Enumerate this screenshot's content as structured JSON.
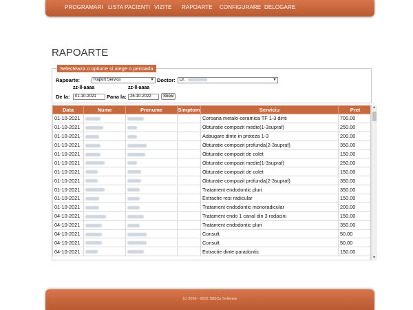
{
  "nav": {
    "items": [
      "PROGRAMARI",
      "LISTA PACIENTI",
      "VIZITE",
      "RAPOARTE",
      "CONFIGURARE",
      "DELOGARE"
    ]
  },
  "page_title": "RAPOARTE",
  "filter": {
    "legend": "Selecteaza o optiune si alege o perioada",
    "rapoarte_label": "Rapoarte:",
    "rapoarte_value": "Raport Servicii",
    "doctor_label": "Doctor:",
    "doctor_value": "Dr.",
    "date_hint_1": "zz-ll-aaaa",
    "date_hint_2": "zz-ll-aaaa",
    "de_la_label": "De la:",
    "de_la_value": "01-10-2021",
    "pana_la_label": "Pana la:",
    "pana_la_value": "26-10-2022",
    "show_button": "Show"
  },
  "table": {
    "headers": [
      "Data",
      "Nume",
      "Prenume",
      "Simptom",
      "Serviciu",
      "Pret"
    ],
    "rows": [
      [
        "01-10-2021",
        "Coroana metalo-ceramica TF 1-3 dinti",
        "700.00"
      ],
      [
        "01-10-2021",
        "Obturatie compozit medie(1-3supraf)",
        "250.00"
      ],
      [
        "01-10-2021",
        "Adaugare dinte in proteza 1-3",
        "200.00"
      ],
      [
        "01-10-2021",
        "Obturatie compozit profunda(2-3supraf)",
        "350.00"
      ],
      [
        "01-10-2021",
        "Obturatie compozit de colet",
        "150.00"
      ],
      [
        "01-10-2021",
        "Obturatie compozit medie(1-3supraf)",
        "250.00"
      ],
      [
        "01-10-2021",
        "Obturatie compozit de colet",
        "150.00"
      ],
      [
        "01-10-2021",
        "Obturatie compozit profunda(2-3supraf)",
        "350.00"
      ],
      [
        "01-10-2021",
        "Tratament endodontic pluri",
        "350.00"
      ],
      [
        "01-10-2021",
        "Extractie rest radicular",
        "150.00"
      ],
      [
        "01-10-2021",
        "Tratament endodontic monoradicular",
        "200.00"
      ],
      [
        "04-10-2021",
        "Tratament endo 1 canal din 3 radacini",
        "150.00"
      ],
      [
        "04-10-2021",
        "Tratament endodontic pluri",
        "350.00"
      ],
      [
        "04-10-2021",
        "Consult",
        "50.00"
      ],
      [
        "04-10-2021",
        "Consult",
        "50.00"
      ],
      [
        "04-10-2021",
        "Extractie dinte paradontic",
        "150.00"
      ]
    ]
  },
  "footer": {
    "text": "(c) 2009 - 2022 StBiCo Software"
  },
  "colors": {
    "accent": "#c86a40",
    "nav_top": "#d8744a",
    "nav_bottom": "#b85a32"
  }
}
